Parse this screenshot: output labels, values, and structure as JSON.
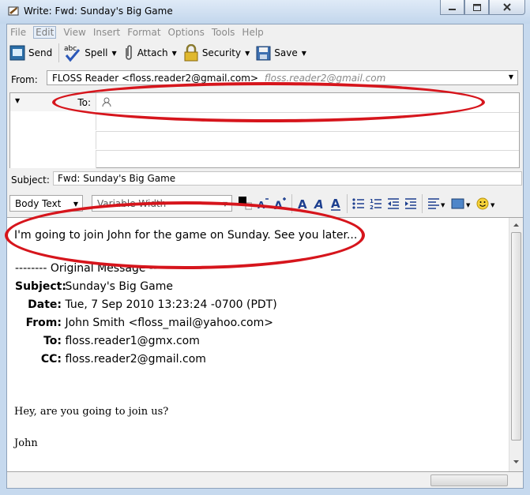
{
  "window": {
    "title": "Write: Fwd: Sunday's Big Game"
  },
  "menu": [
    "File",
    "Edit",
    "View",
    "Insert",
    "Format",
    "Options",
    "Tools",
    "Help"
  ],
  "toolbar": {
    "send": "Send",
    "spell": "Spell",
    "attach": "Attach",
    "security": "Security",
    "save": "Save"
  },
  "header": {
    "from_label": "From:",
    "from_value": "FLOSS Reader <floss.reader2@gmail.com>",
    "from_alt": "floss.reader2@gmail.com",
    "to_label": "To:",
    "subject_label": "Subject:",
    "subject_value": "Fwd: Sunday's Big Game"
  },
  "format": {
    "paragraph": "Body Text",
    "font": "Variable Width"
  },
  "body": {
    "message": "I'm going to join John for the game on Sunday. See you later...",
    "original_marker": "-------- Original Message --------",
    "original": {
      "subject_label": "Subject:",
      "subject": "Sunday's Big Game",
      "date_label": "Date:",
      "date": "Tue, 7 Sep 2010 13:23:24 -0700 (PDT)",
      "from_label": "From:",
      "from": "John Smith <floss_mail@yahoo.com>",
      "to_label": "To:",
      "to": "floss.reader1@gmx.com",
      "cc_label": "CC:",
      "cc": "floss.reader2@gmail.com"
    },
    "line1": "Hey, are you going to join us?",
    "signature": "John"
  },
  "annotation_color": "#d6151c"
}
